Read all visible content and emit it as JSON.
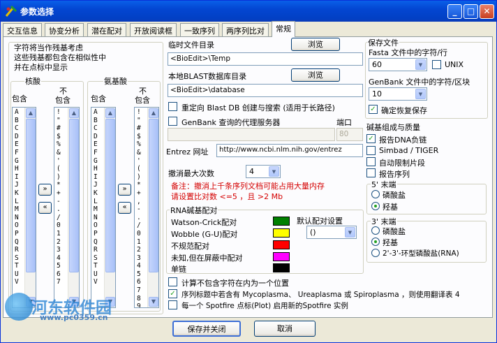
{
  "window": {
    "title": "参数选择"
  },
  "tabs": [
    "交互信息",
    "协变分析",
    "潜在配对",
    "开放阅读框",
    "一致序列",
    "两序列比对",
    "常规"
  ],
  "residues": {
    "caption": [
      "字符将当作残基考虑",
      "这些残基都包含在相似性中",
      "并在点标中显示"
    ],
    "nucleotide": {
      "title": "核酸",
      "include": "包含",
      "exclude_line1": "不",
      "exclude_line2": "包含",
      "include_items": [
        "A",
        "B",
        "C",
        "D",
        "E",
        "F",
        "G",
        "H",
        "I",
        "J",
        "K",
        "L",
        "M",
        "N",
        "O",
        "P",
        "Q",
        "R",
        "S",
        "T",
        "U",
        "V"
      ],
      "exclude_items": [
        "!",
        "\"",
        "#",
        "$",
        "%",
        "&",
        "'",
        "(",
        ")",
        "*",
        "+",
        "-",
        ".",
        "/",
        "0",
        "1",
        "2",
        "3",
        "4",
        "5",
        "6",
        "7"
      ]
    },
    "amino": {
      "title": "氨基酸",
      "include": "包含",
      "exclude_line1": "不",
      "exclude_line2": "包含",
      "include_items": [
        "A",
        "B",
        "C",
        "D",
        "E",
        "F",
        "G",
        "H",
        "I",
        "J",
        "K",
        "L",
        "M",
        "N",
        "O",
        "P",
        "Q",
        "R",
        "S",
        "T",
        "U",
        "V"
      ],
      "exclude_items": [
        "!",
        "\"",
        "#",
        "$",
        "%",
        "&",
        "'",
        "(",
        ")",
        "*",
        "+",
        ",",
        "-",
        ".",
        "/",
        "0",
        "1",
        "2",
        "3",
        "4",
        "5",
        "6",
        "7",
        "8",
        "9"
      ]
    },
    "move_right": "»",
    "move_left": "«"
  },
  "paths": {
    "temp_label": "临时文件目录",
    "temp_value": "<BioEdit>\\Temp",
    "browse": "浏览",
    "blast_label": "本地BLAST数据库目录",
    "blast_value": "<BioEdit>\\database",
    "redirect": "重定向 Blast DB 创建与搜索 (适用于长路径)",
    "proxy": "GenBank 查询的代理服务器",
    "port_label": "端口",
    "port_value": "80",
    "entrez_label": "Entrez 网址",
    "entrez_value": "http://www.ncbi.nlm.nih.gov/entrez"
  },
  "undo": {
    "label": "撤消最大次数",
    "value": "4",
    "note1": "备注：撤消上千条序列文档可能占用大量内存",
    "note2": "请设置比对数 <=5 ，且 >2 Mb"
  },
  "rna": {
    "title": "RNA碱基配对",
    "default_label": "默认配对设置",
    "default_value": "()",
    "pairs": [
      {
        "label": "Watson-Crick配对",
        "color": "#008000"
      },
      {
        "label": "Wobble (G-U)配对",
        "color": "#ffff00"
      },
      {
        "label": "不规范配对",
        "color": "#ff0000"
      },
      {
        "label": "未知,但在屏蔽中配对",
        "color": "#ff00ff"
      },
      {
        "label": "单链",
        "color": "#000000"
      }
    ]
  },
  "options": [
    {
      "label": "计算不包含字符在内为一个位置",
      "checked": false
    },
    {
      "label": "序列标题中若含有 Mycoplasma、 Ureaplasma 或 Spiroplasma ，则使用翻译表 4",
      "checked": true
    },
    {
      "label": "每一个 Spotfire 点标(Plot) 启用新的Spotfire 实例",
      "checked": false
    }
  ],
  "save": {
    "title": "保存文件",
    "fasta_label": "Fasta 文件中的字符/行",
    "fasta_value": "60",
    "unix_label": "UNIX",
    "genbank_label": "GenBank 文件中的字符/区块",
    "genbank_value": "10",
    "confirm_label": "确定恢复保存"
  },
  "composition": {
    "title": "碱基组成与质量",
    "items": [
      "报告DNA负链",
      "Simbad / TIGER",
      "自动限制片段",
      "报告序列"
    ],
    "checked": [
      true,
      false,
      false,
      false
    ]
  },
  "end5": {
    "title": "5' 末端",
    "options": [
      "磷酸盐",
      "羟基"
    ],
    "selected": 1
  },
  "end3": {
    "title": "3' 末端",
    "options": [
      "磷酸盐",
      "羟基",
      "2'-3'-环型磷酸盐(RNA)"
    ],
    "selected": 1
  },
  "footer": {
    "save_close": "保存并关闭",
    "cancel": "取消"
  },
  "watermark": {
    "text": "河东软件园",
    "url": "www.pc0359.cn"
  }
}
